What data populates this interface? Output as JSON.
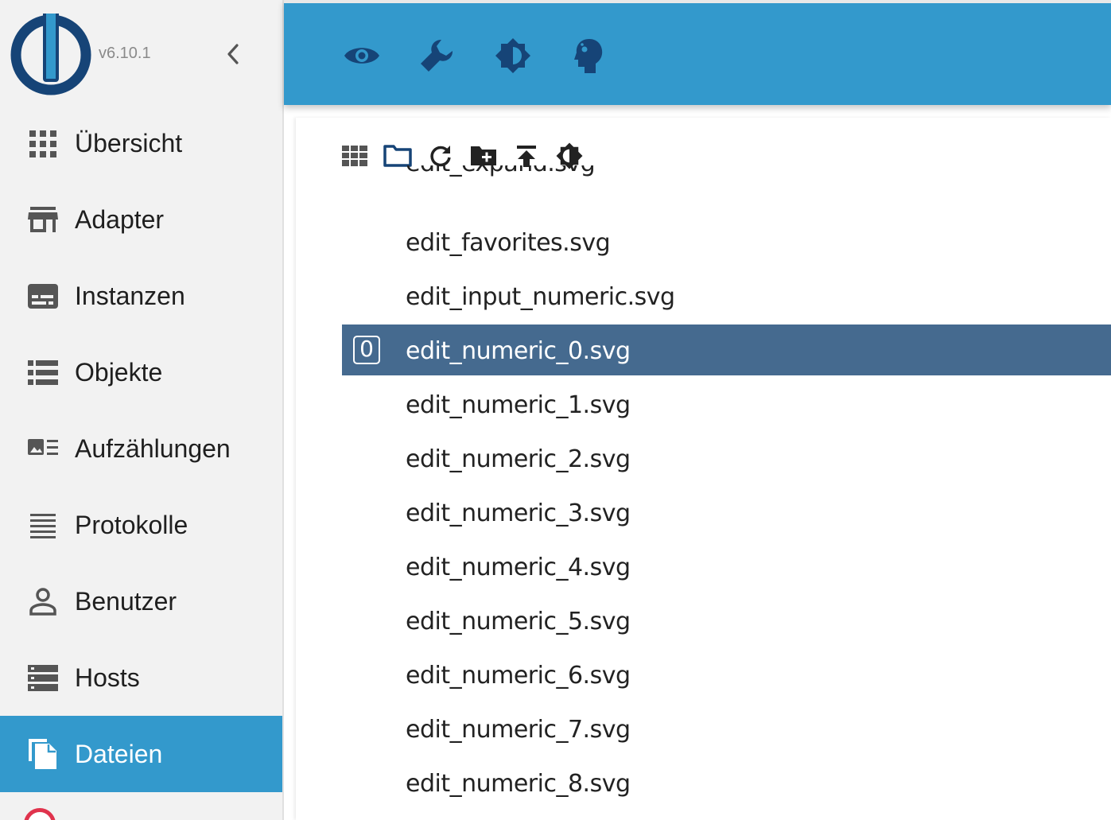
{
  "app": {
    "version": "v6.10.1"
  },
  "colors": {
    "accent": "#3399cc",
    "sidebar_bg": "#f2f2f2",
    "selected_row": "#456a8f",
    "icon_dark": "#164477"
  },
  "header": {
    "buttons": [
      {
        "icon": "eye-icon"
      },
      {
        "icon": "wrench-icon"
      },
      {
        "icon": "brightness-icon"
      },
      {
        "icon": "expert-head-icon"
      }
    ]
  },
  "sidebar": {
    "collapse_icon": "chevron-left-icon",
    "items": [
      {
        "label": "Übersicht",
        "icon": "apps-grid-icon"
      },
      {
        "label": "Adapter",
        "icon": "store-icon"
      },
      {
        "label": "Instanzen",
        "icon": "subtitles-icon"
      },
      {
        "label": "Objekte",
        "icon": "list-icon"
      },
      {
        "label": "Aufzählungen",
        "icon": "image-list-icon"
      },
      {
        "label": "Protokolle",
        "icon": "lines-icon"
      },
      {
        "label": "Benutzer",
        "icon": "person-icon"
      },
      {
        "label": "Hosts",
        "icon": "storage-icon"
      },
      {
        "label": "Dateien",
        "icon": "files-icon",
        "active": true
      }
    ]
  },
  "file_browser": {
    "toolbar": [
      {
        "icon": "tile-view-icon"
      },
      {
        "icon": "folder-icon"
      },
      {
        "icon": "refresh-icon"
      },
      {
        "icon": "new-folder-icon"
      },
      {
        "icon": "upload-icon"
      },
      {
        "icon": "brightness-icon"
      }
    ],
    "files": [
      {
        "name": "edit_expand.svg"
      },
      {
        "name": "edit_favorites.svg"
      },
      {
        "name": "edit_input_numeric.svg"
      },
      {
        "name": "edit_numeric_0.svg",
        "selected": true,
        "icon_glyph": "0"
      },
      {
        "name": "edit_numeric_1.svg"
      },
      {
        "name": "edit_numeric_2.svg"
      },
      {
        "name": "edit_numeric_3.svg"
      },
      {
        "name": "edit_numeric_4.svg"
      },
      {
        "name": "edit_numeric_5.svg"
      },
      {
        "name": "edit_numeric_6.svg"
      },
      {
        "name": "edit_numeric_7.svg"
      },
      {
        "name": "edit_numeric_8.svg"
      }
    ]
  }
}
